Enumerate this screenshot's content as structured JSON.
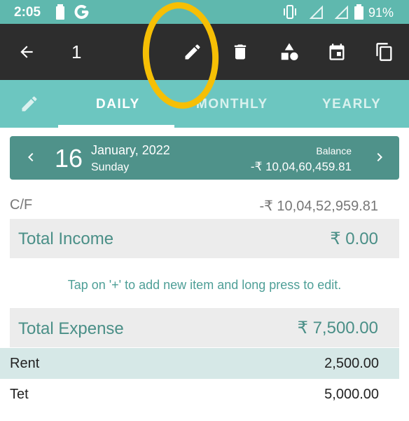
{
  "status": {
    "time": "2:05",
    "battery": "91%"
  },
  "toolbar": {
    "title": "1"
  },
  "tabs": [
    {
      "label": "DAILY"
    },
    {
      "label": "MONTHLY"
    },
    {
      "label": "YEARLY"
    }
  ],
  "date_card": {
    "day": "16",
    "month_year": "January, 2022",
    "weekday": "Sunday",
    "balance_label": "Balance",
    "balance_value": "-₹ 10,04,60,459.81"
  },
  "carry_forward": {
    "label": "C/F",
    "value": "-₹ 10,04,52,959.81"
  },
  "income": {
    "label": "Total Income",
    "value": "₹ 0.00"
  },
  "hint": "Tap on '+' to add new item and long press to edit.",
  "expense": {
    "label": "Total Expense",
    "value": "₹ 7,500.00",
    "items": [
      {
        "name": "Rent",
        "amount": "2,500.00"
      },
      {
        "name": "Tet",
        "amount": "5,000.00"
      }
    ]
  }
}
